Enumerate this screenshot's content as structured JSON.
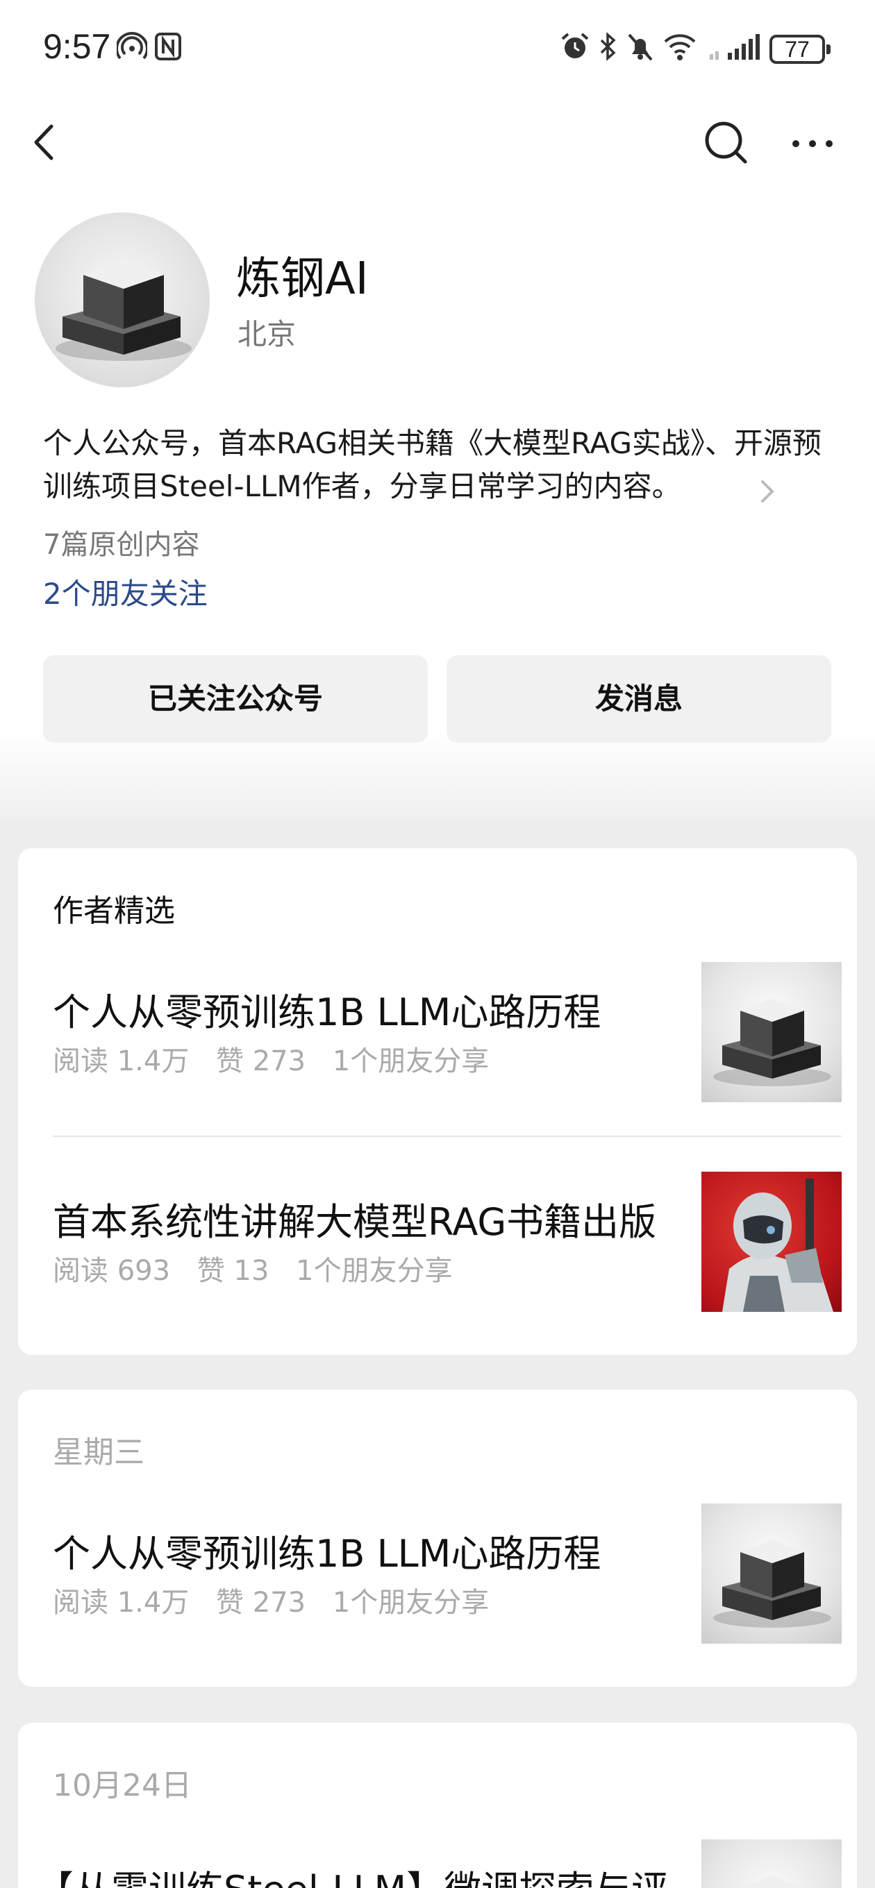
{
  "status_bar": {
    "time": "9:57",
    "battery": "77"
  },
  "nav": {
    "back_icon": "chevron-left-icon",
    "search_icon": "search-icon",
    "more_icon": "more-horizontal-icon"
  },
  "profile": {
    "name": "炼钢AI",
    "location": "北京",
    "bio": "个人公众号，首本RAG相关书籍《大模型RAG实战》、开源预训练项目Steel-LLM作者，分享日常学习的内容。",
    "original_count": "7篇原创内容",
    "friends_following": "2个朋友关注",
    "follow_button": "已关注公众号",
    "message_button": "发消息"
  },
  "sections": [
    {
      "header": "作者精选",
      "articles": [
        {
          "title": "个人从零预训练1B LLM心路历程",
          "reads": "阅读 1.4万",
          "likes": "赞 273",
          "shares": "1个朋友分享",
          "thumb": "cube"
        },
        {
          "title": "首本系统性讲解大模型RAG书籍出版",
          "reads": "阅读 693",
          "likes": "赞 13",
          "shares": "1个朋友分享",
          "thumb": "robot"
        }
      ]
    },
    {
      "header": "星期三",
      "articles": [
        {
          "title": "个人从零预训练1B LLM心路历程",
          "reads": "阅读 1.4万",
          "likes": "赞 273",
          "shares": "1个朋友分享",
          "thumb": "cube"
        }
      ]
    },
    {
      "header": "10月24日",
      "articles": [
        {
          "title": "【从零训练Steel-LLM】微调探索与评",
          "thumb": "cube"
        }
      ]
    }
  ],
  "colors": {
    "link_blue": "#2a4a8a",
    "background": "#ededed",
    "card": "#ffffff",
    "meta_grey": "#aaaaaa"
  }
}
